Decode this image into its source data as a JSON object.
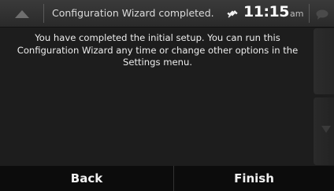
{
  "header": {
    "title": "Configuration Wizard completed.",
    "time": "11:15",
    "ampm": "am"
  },
  "content": {
    "message": "You have completed the initial setup. You can run this Configuration Wizard any time or change other options in the Settings menu."
  },
  "footer": {
    "back_label": "Back",
    "finish_label": "Finish"
  },
  "icons": {
    "up": "up-arrow-icon",
    "satellite": "satellite-icon",
    "messages": "speech-bubble-icon",
    "scroll_down": "down-arrow-icon"
  }
}
